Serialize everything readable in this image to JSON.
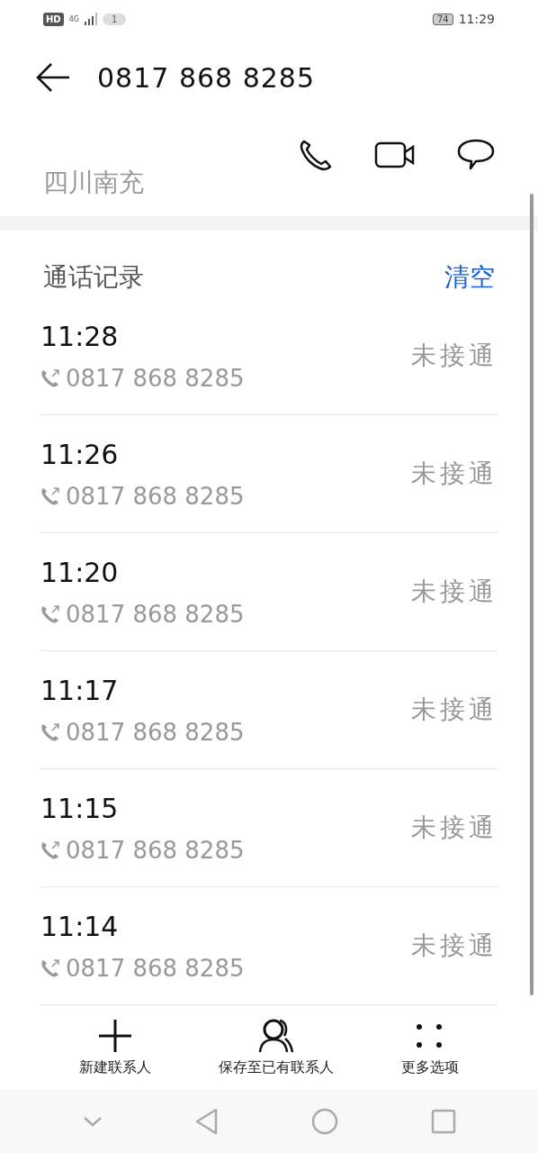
{
  "status_bar": {
    "hd": "HD",
    "network": "4G",
    "sim_badge": "1",
    "battery": "74",
    "time": "11:29"
  },
  "header": {
    "title": "0817 868 8285"
  },
  "contact": {
    "location": "四川南充"
  },
  "section": {
    "title": "通话记录",
    "action": "清空"
  },
  "calls": [
    {
      "time": "11:28",
      "number": "0817 868 8285",
      "status": "未接通"
    },
    {
      "time": "11:26",
      "number": "0817 868 8285",
      "status": "未接通"
    },
    {
      "time": "11:20",
      "number": "0817 868 8285",
      "status": "未接通"
    },
    {
      "time": "11:17",
      "number": "0817 868 8285",
      "status": "未接通"
    },
    {
      "time": "11:15",
      "number": "0817 868 8285",
      "status": "未接通"
    },
    {
      "time": "11:14",
      "number": "0817 868 8285",
      "status": "未接通"
    }
  ],
  "actions": [
    {
      "kind": "add",
      "label": "新建联系人"
    },
    {
      "kind": "person",
      "label": "保存至已有联系人"
    },
    {
      "kind": "more",
      "label": "更多选项"
    }
  ]
}
